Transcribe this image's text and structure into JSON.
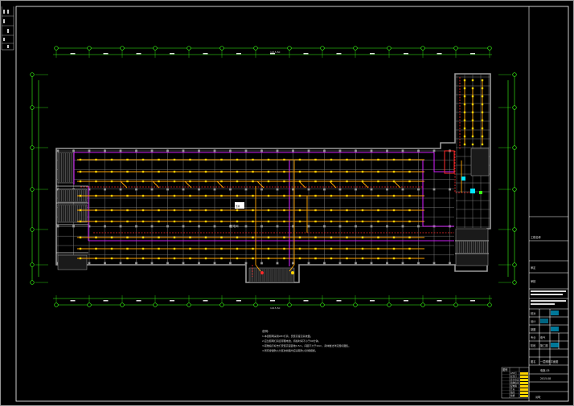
{
  "drawing": {
    "overall_dim_top": "1015.50",
    "overall_dim_bottom": "1015.50",
    "room_label": "配电间",
    "room_note": "竖井",
    "notes_title": "说明：",
    "notes": [
      "1.本层照明采用LED灯具，安装高度见系统图。",
      "2.应急照明灯具自带蓄电池，持续时间不小于90分钟。",
      "3.疏散指示标志灯安装高度距地0.5m，间距不大于20m，具体做法详见国标图集。",
      "4.所有穿越防火分区的线路均应采取防火封堵措施。"
    ]
  },
  "title_block": {
    "project_label": "工程名称",
    "rows": [
      {
        "k": "审定",
        "v": ""
      },
      {
        "k": "审核",
        "v": ""
      },
      {
        "k": "校对",
        "v": ""
      },
      {
        "k": "设计",
        "v": ""
      },
      {
        "k": "制图",
        "v": ""
      },
      {
        "k": "专业",
        "v": "电气"
      },
      {
        "k": "阶段",
        "v": "施工图"
      },
      {
        "k": "图名",
        "v": "一层照明平面图"
      }
    ],
    "sheet_no": "电施-05",
    "date": "2015.08"
  },
  "legend": {
    "title": "图例",
    "items": [
      "LED灯",
      "应急灯",
      "安全出口",
      "疏散指示",
      "配电箱",
      "开关",
      "插座",
      "线槽"
    ]
  }
}
